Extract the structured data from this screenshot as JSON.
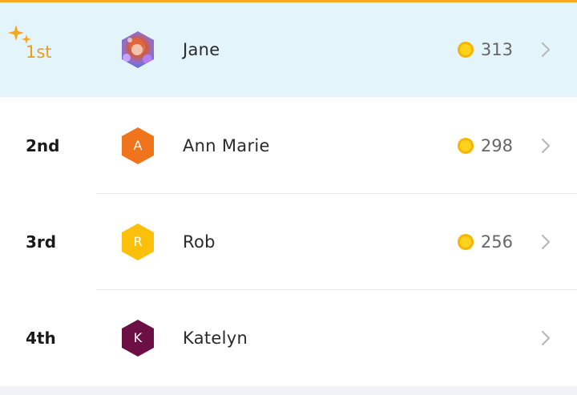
{
  "leaderboard": {
    "entries": [
      {
        "rank": "1st",
        "name": "Jane",
        "score": "313",
        "avatar_type": "photo",
        "avatar_letter": "",
        "avatar_color": "#8e6fd1",
        "highlighted": true,
        "icon": "sparkle-icon"
      },
      {
        "rank": "2nd",
        "name": "Ann Marie",
        "score": "298",
        "avatar_type": "letter",
        "avatar_letter": "A",
        "avatar_color": "#f0741c",
        "highlighted": false
      },
      {
        "rank": "3rd",
        "name": "Rob",
        "score": "256",
        "avatar_type": "letter",
        "avatar_letter": "R",
        "avatar_color": "#fcbf0a",
        "highlighted": false
      },
      {
        "rank": "4th",
        "name": "Katelyn",
        "score": "",
        "avatar_type": "letter",
        "avatar_letter": "K",
        "avatar_color": "#6b0f45",
        "highlighted": false
      }
    ]
  },
  "colors": {
    "accent_top_line": "#f5a623",
    "highlight_row": "#e3f5fb",
    "coin_gold": "#fcd21c",
    "coin_ring": "#f7b500",
    "first_place_text": "#f39c12"
  },
  "icons": {
    "coin": "coin-icon",
    "chevron": "chevron-right-icon",
    "sparkle": "sparkle-icon"
  }
}
